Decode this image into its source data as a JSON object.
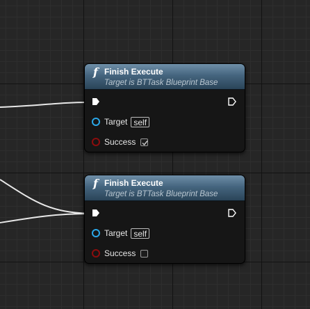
{
  "nodes": [
    {
      "title": "Finish Execute",
      "subtitle": "Target is BTTask Blueprint Base",
      "icon": "function-icon",
      "target_label": "Target",
      "target_value": "self",
      "success_label": "Success",
      "success_checked": true
    },
    {
      "title": "Finish Execute",
      "subtitle": "Target is BTTask Blueprint Base",
      "icon": "function-icon",
      "target_label": "Target",
      "target_value": "self",
      "success_label": "Success",
      "success_checked": false
    }
  ],
  "colors": {
    "graph_background": "#262626",
    "node_header": "#45657f",
    "object_pin": "#2aa7e8",
    "bool_pin": "#8c0d0d",
    "exec_pin": "#ffffff",
    "wire": "#e8e8e8"
  },
  "fn_glyph": "f"
}
